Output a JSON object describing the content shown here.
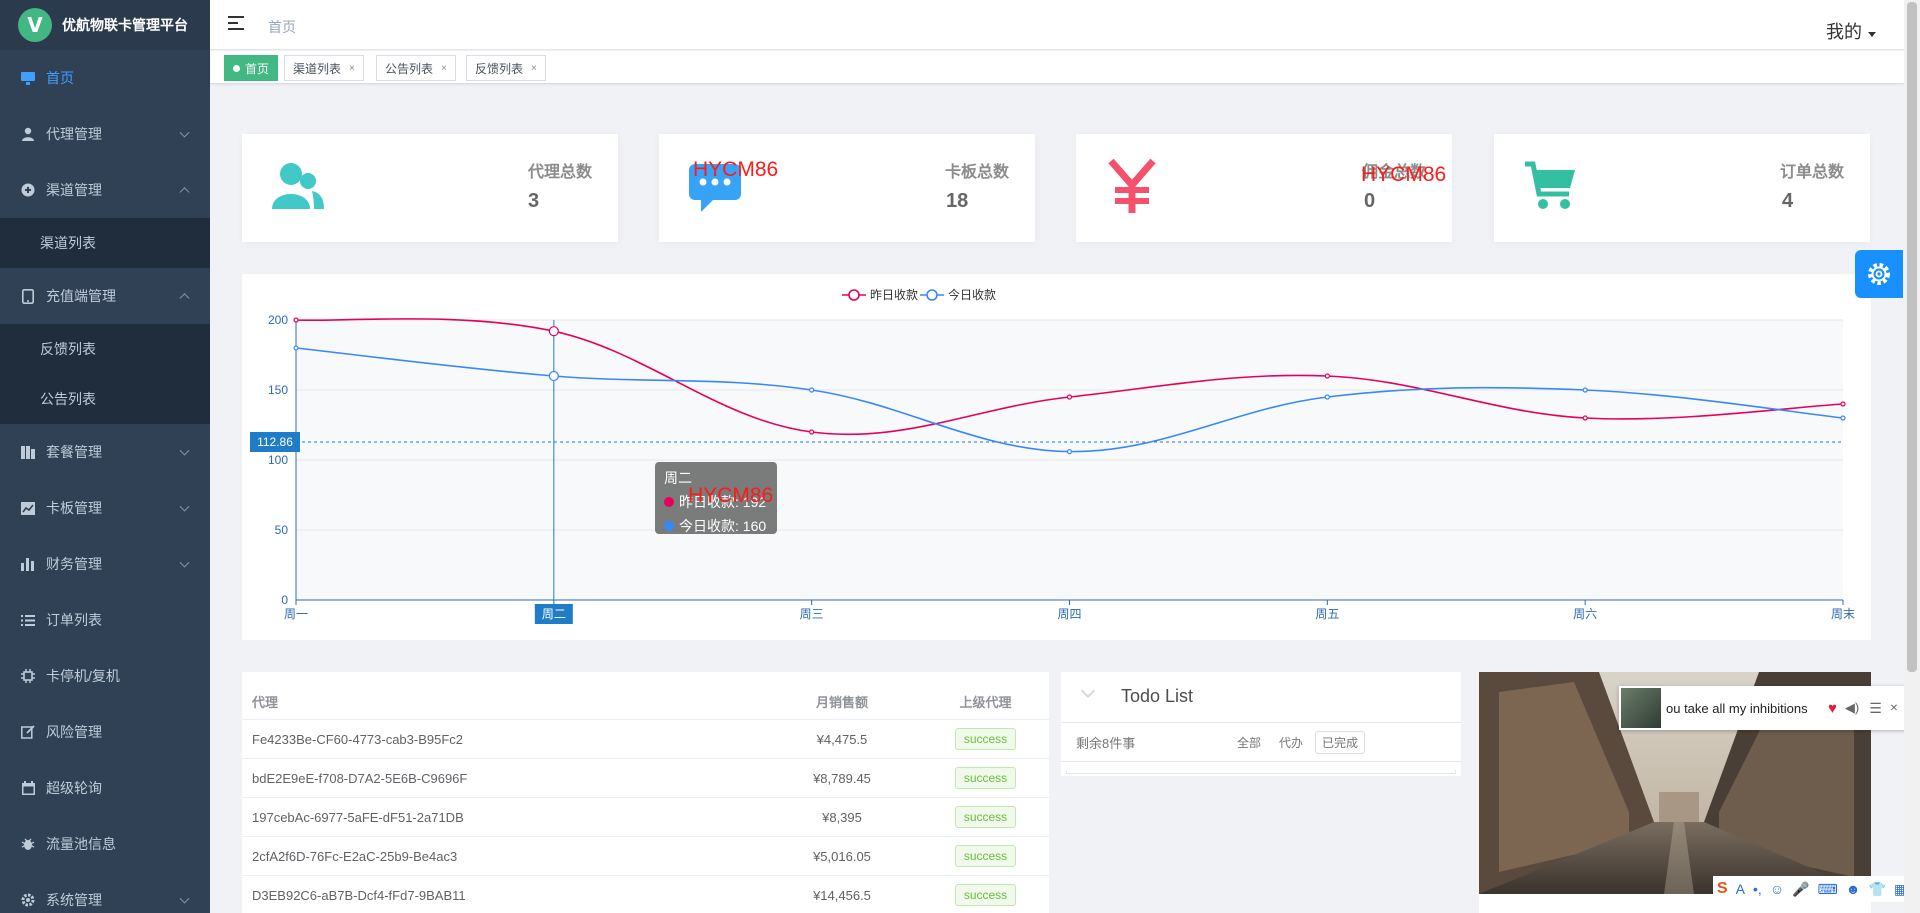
{
  "app": {
    "logo_letter": "V",
    "title": "优航物联卡管理平台"
  },
  "sidebar": {
    "items": [
      {
        "label": "首页",
        "icon": "monitor-icon",
        "active": true
      },
      {
        "label": "代理管理",
        "icon": "user-icon",
        "expandable": true
      },
      {
        "label": "渠道管理",
        "icon": "compass-icon",
        "expandable": true,
        "expanded": true,
        "children": [
          "渠道列表"
        ]
      },
      {
        "label": "充值端管理",
        "icon": "tablet-icon",
        "expandable": true,
        "expanded": true,
        "children": [
          "反馈列表",
          "公告列表"
        ]
      },
      {
        "label": "套餐管理",
        "icon": "package-icon",
        "expandable": true
      },
      {
        "label": "卡板管理",
        "icon": "chart-line-icon",
        "expandable": true
      },
      {
        "label": "财务管理",
        "icon": "bar-chart-icon",
        "expandable": true
      },
      {
        "label": "订单列表",
        "icon": "list-icon"
      },
      {
        "label": "卡停机/复机",
        "icon": "chip-icon"
      },
      {
        "label": "风险管理",
        "icon": "edit-icon"
      },
      {
        "label": "超级轮询",
        "icon": "calendar-icon"
      },
      {
        "label": "流量池信息",
        "icon": "bug-icon"
      },
      {
        "label": "系统管理",
        "icon": "gear-icon",
        "expandable": true
      }
    ]
  },
  "navbar": {
    "breadcrumb": "首页",
    "user": "我的"
  },
  "tags": [
    {
      "label": "首页",
      "active": true
    },
    {
      "label": "渠道列表",
      "close": "×"
    },
    {
      "label": "公告列表",
      "close": "×"
    },
    {
      "label": "反馈列表",
      "close": "×"
    }
  ],
  "cards": [
    {
      "label": "代理总数",
      "value": "3",
      "icon": "people-icon",
      "color": "#40c9c6"
    },
    {
      "label": "卡板总数",
      "value": "18",
      "icon": "message-icon",
      "color": "#36a3f7"
    },
    {
      "label": "佣金总数",
      "value": "0",
      "icon": "yen-icon",
      "color": "#f4516c"
    },
    {
      "label": "订单总数",
      "value": "4",
      "icon": "cart-icon",
      "color": "#34bfa3"
    }
  ],
  "watermarks": [
    "HYCM86",
    "HYCM86",
    "HYCM86"
  ],
  "chart_data": {
    "type": "line",
    "categories": [
      "周一",
      "周二",
      "周三",
      "周四",
      "周五",
      "周六",
      "周末"
    ],
    "series": [
      {
        "name": "昨日收款",
        "values": [
          200,
          192,
          120,
          145,
          160,
          130,
          140
        ],
        "color": "#e6005c"
      },
      {
        "name": "今日收款",
        "values": [
          180,
          160,
          150,
          106,
          145,
          150,
          130
        ],
        "color": "#3888fa"
      }
    ],
    "ylim": [
      0,
      200
    ],
    "yticks": [
      0,
      50,
      100,
      150,
      200
    ],
    "crosshair": {
      "category": "周二",
      "y_label": "112.86",
      "y_value": 112.86
    },
    "tooltip": {
      "title": "周二",
      "rows": [
        "昨日收款: 192",
        "今日收款: 160"
      ]
    },
    "legend": "top-center"
  },
  "table": {
    "headers": [
      "代理",
      "月销售额",
      "上级代理"
    ],
    "rows": [
      [
        "Fe4233Be-CF60-4773-cab3-B95Fc2",
        "¥4,475.5",
        "success"
      ],
      [
        "bdE2E9eE-f708-D7A2-5E6B-C9696F",
        "¥8,789.45",
        "success"
      ],
      [
        "197cebAc-6977-5aFE-dF51-2a71DB",
        "¥8,395",
        "success"
      ],
      [
        "2cfA2f6D-76Fc-E2aC-25b9-Be4ac3",
        "¥5,016.05",
        "success"
      ],
      [
        "D3EB92C6-aB7B-Dcf4-fFd7-9BAB11",
        "¥14,456.5",
        "success"
      ]
    ]
  },
  "todo": {
    "title": "Todo List",
    "remaining": "剩余8件事",
    "filters": [
      "全部",
      "代办",
      "已完成"
    ],
    "selected_filter": "已完成"
  },
  "music": {
    "text": "ou take all my inhibitions"
  }
}
